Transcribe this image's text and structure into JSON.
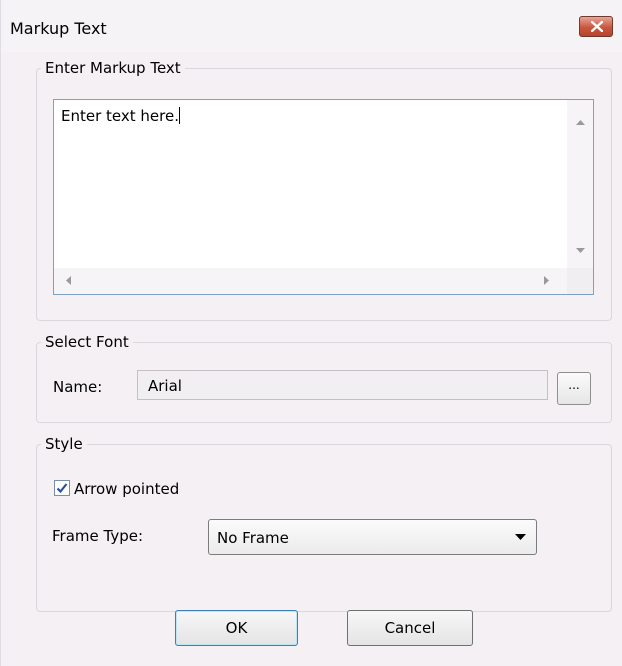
{
  "window": {
    "title": "Markup Text",
    "close_icon": "close-icon"
  },
  "markup_group": {
    "legend": "Enter Markup Text",
    "text_value": "Enter text here."
  },
  "font_group": {
    "legend": "Select Font",
    "name_label": "Name:",
    "name_value": "Arial",
    "browse_label": "..."
  },
  "style_group": {
    "legend": "Style",
    "arrow_pointed_label": "Arrow pointed",
    "arrow_pointed_checked": true,
    "frame_type_label": "Frame Type:",
    "frame_type_value": "No Frame"
  },
  "buttons": {
    "ok": "OK",
    "cancel": "Cancel"
  },
  "colors": {
    "close_button": "#c9573f",
    "textarea_border": "#7fa1c4",
    "default_button_border": "#3c7fb1"
  }
}
